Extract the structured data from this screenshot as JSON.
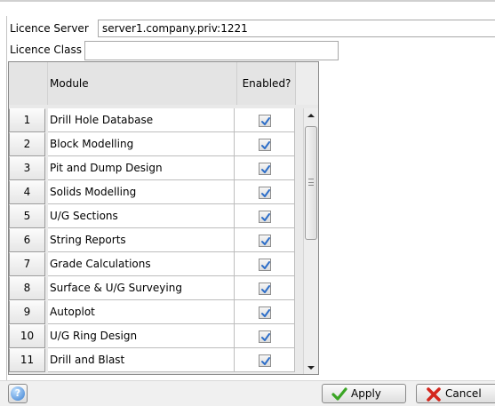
{
  "form": {
    "server_label": "Licence Server",
    "server_value": "server1.company.priv:1221",
    "class_label": "Licence Class",
    "class_value": ""
  },
  "table": {
    "columns": [
      "Module",
      "Enabled?"
    ],
    "rows": [
      {
        "num": "1",
        "module": "Drill Hole Database",
        "enabled": true
      },
      {
        "num": "2",
        "module": "Block Modelling",
        "enabled": true
      },
      {
        "num": "3",
        "module": "Pit and Dump Design",
        "enabled": true
      },
      {
        "num": "4",
        "module": "Solids Modelling",
        "enabled": true
      },
      {
        "num": "5",
        "module": "U/G Sections",
        "enabled": true
      },
      {
        "num": "6",
        "module": "String Reports",
        "enabled": true
      },
      {
        "num": "7",
        "module": "Grade Calculations",
        "enabled": true
      },
      {
        "num": "8",
        "module": "Surface & U/G Surveying",
        "enabled": true
      },
      {
        "num": "9",
        "module": "Autoplot",
        "enabled": true
      },
      {
        "num": "10",
        "module": "U/G Ring Design",
        "enabled": true
      },
      {
        "num": "11",
        "module": "Drill and Blast",
        "enabled": true
      }
    ]
  },
  "buttons": {
    "apply_label": "Apply",
    "cancel_label": "Cancel"
  },
  "icons": {
    "help": "help-icon",
    "apply": "checkmark-icon",
    "cancel": "x-icon",
    "checkbox": "checkbox-checked-icon",
    "scroll_up": "arrow-up-icon",
    "scroll_down": "arrow-down-icon"
  },
  "colors": {
    "checkmark": "#2f6fc8",
    "apply_icon": "#3aa524",
    "cancel_icon": "#d4271e",
    "help_icon": "#3b7fd0"
  }
}
